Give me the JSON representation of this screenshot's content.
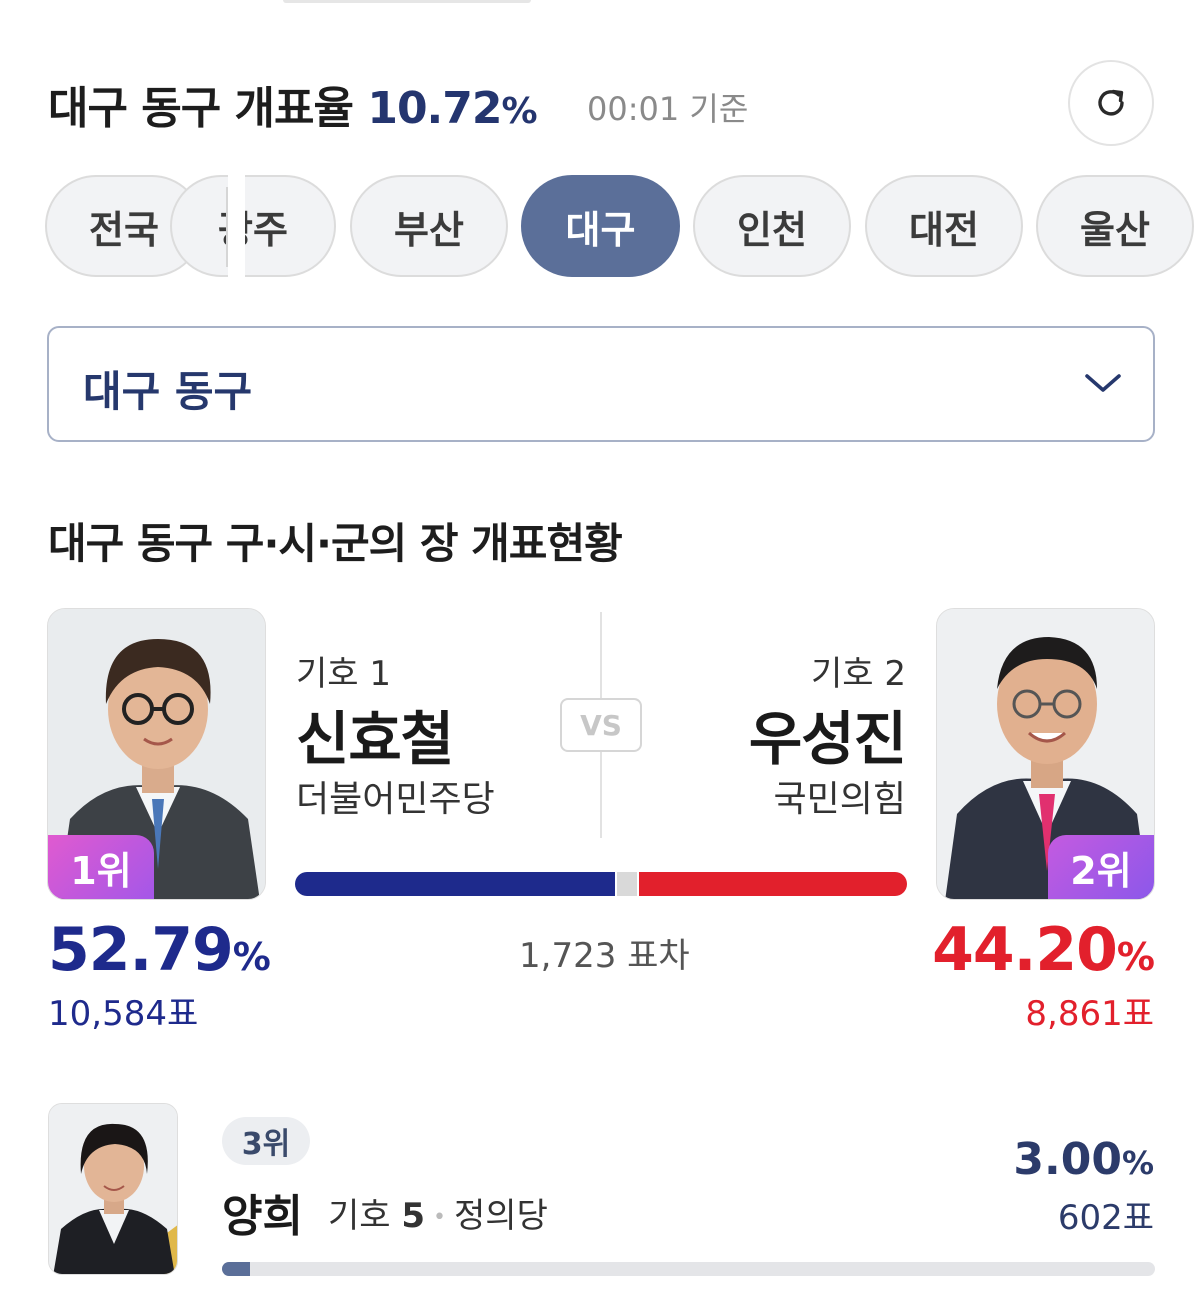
{
  "header": {
    "title": "대구 동구 개표율",
    "rate_value": "10.72",
    "rate_unit": "%",
    "time": "00:01 기준"
  },
  "regions": [
    {
      "label": "전국",
      "active": false
    },
    {
      "label": "광주",
      "active": false
    },
    {
      "label": "부산",
      "active": false
    },
    {
      "label": "대구",
      "active": true
    },
    {
      "label": "인천",
      "active": false
    },
    {
      "label": "대전",
      "active": false
    },
    {
      "label": "울산",
      "active": false
    }
  ],
  "district_select": {
    "value": "대구 동구"
  },
  "section_title": "대구 동구 구·시·군의 장 개표현황",
  "vs_label": "VS",
  "candidates": [
    {
      "rank": "1위",
      "number": "기호 1",
      "name": "신효철",
      "party": "더불어민주당",
      "pct": "52.79",
      "pct_unit": "%",
      "votes": "10,584표",
      "color": "#1e2a8c"
    },
    {
      "rank": "2위",
      "number": "기호 2",
      "name": "우성진",
      "party": "국민의힘",
      "pct": "44.20",
      "pct_unit": "%",
      "votes": "8,861표",
      "color": "#e2202c"
    },
    {
      "rank": "3위",
      "number_prefix": "기호",
      "number_value": "5",
      "name": "양희",
      "party": "정의당",
      "pct": "3.00",
      "pct_unit": "%",
      "votes": "602표",
      "share": 0.03
    }
  ],
  "vote_difference": "1,723 표차",
  "icons": {
    "refresh": "refresh-icon",
    "dropdown": "chevron-down-icon"
  }
}
